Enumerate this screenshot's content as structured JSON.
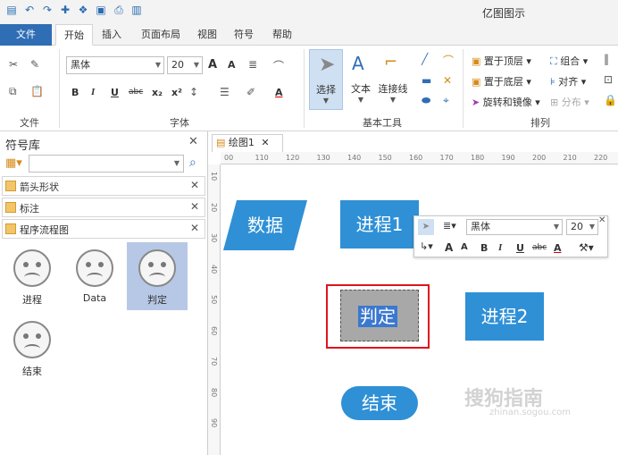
{
  "app": {
    "title": "亿图图示"
  },
  "tabs": [
    {
      "label": "文件"
    },
    {
      "label": "开始"
    },
    {
      "label": "插入"
    },
    {
      "label": "页面布局"
    },
    {
      "label": "视图"
    },
    {
      "label": "符号"
    },
    {
      "label": "帮助"
    }
  ],
  "ribbon": {
    "groups": {
      "file": "文件",
      "font": "字体",
      "basic_tools": "基本工具",
      "arrange": "排列"
    },
    "font_name": "黑体",
    "font_size": "20",
    "format": {
      "bold": "B",
      "italic": "I",
      "underline": "U",
      "strike": "abc",
      "sub": "x₂",
      "sup": "x²",
      "grow": "A",
      "shrink": "A",
      "color": "A"
    },
    "tools": {
      "select": "选择",
      "text": "文本",
      "connector": "连接线"
    },
    "arrange": {
      "bring_front": "置于顶层",
      "send_back": "置于底层",
      "rotate": "旋转和镜像",
      "group": "组合",
      "align": "对齐",
      "distribute": "分布"
    }
  },
  "library": {
    "title": "符号库",
    "categories": [
      "箭头形状",
      "标注",
      "程序流程图"
    ],
    "symbols": [
      "进程",
      "Data",
      "判定",
      "结束"
    ]
  },
  "document": {
    "tab": "绘图1"
  },
  "ruler": {
    "h": [
      "00",
      "110",
      "120",
      "130",
      "140",
      "150",
      "160",
      "170",
      "180",
      "190",
      "200",
      "210",
      "220"
    ],
    "v": [
      "10",
      "20",
      "30",
      "40",
      "50",
      "60",
      "70",
      "80",
      "90"
    ]
  },
  "canvas": {
    "shape_data": "数据",
    "shape_process1": "进程1",
    "shape_decision": "判定",
    "shape_process2": "进程2",
    "shape_end": "结束"
  },
  "float_toolbar": {
    "font_name": "黑体",
    "font_size": "20"
  },
  "watermark": {
    "text": "搜狗指南",
    "url": "zhinan.sogou.com"
  }
}
